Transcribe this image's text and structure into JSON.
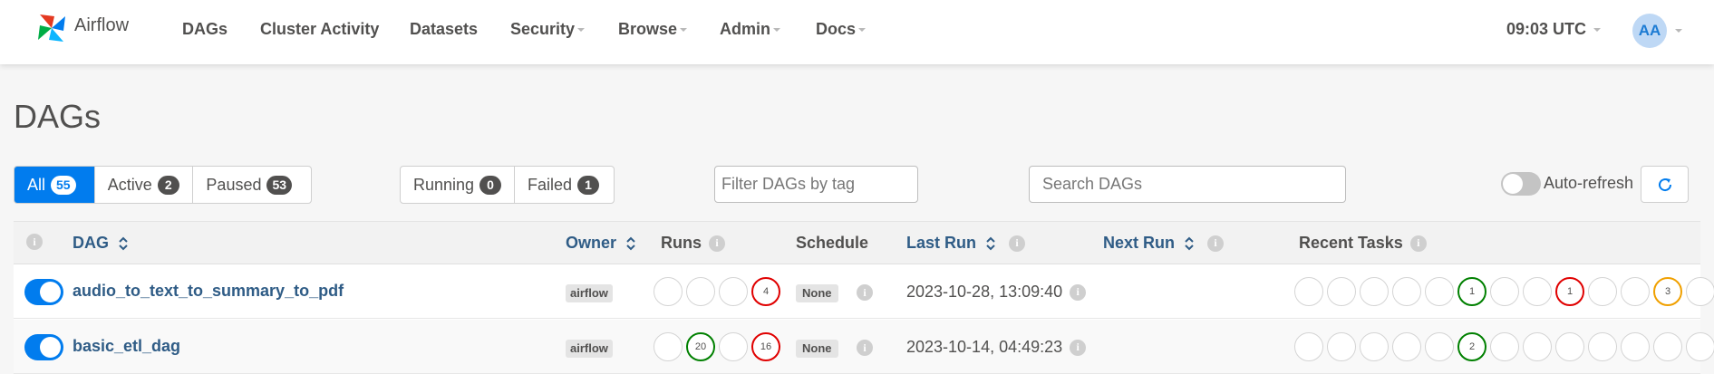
{
  "navbar": {
    "brand": "Airflow",
    "items": [
      {
        "label": "DAGs",
        "dropdown": false
      },
      {
        "label": "Cluster Activity",
        "dropdown": false
      },
      {
        "label": "Datasets",
        "dropdown": false
      },
      {
        "label": "Security",
        "dropdown": true
      },
      {
        "label": "Browse",
        "dropdown": true
      },
      {
        "label": "Admin",
        "dropdown": true
      },
      {
        "label": "Docs",
        "dropdown": true
      }
    ],
    "clock": "09:03 UTC",
    "avatar": "AA"
  },
  "page": {
    "title": "DAGs"
  },
  "status_filter": [
    {
      "label": "All",
      "count": "55"
    },
    {
      "label": "Active",
      "count": "2"
    },
    {
      "label": "Paused",
      "count": "53"
    }
  ],
  "run_filter": [
    {
      "label": "Running",
      "count": "0"
    },
    {
      "label": "Failed",
      "count": "1"
    }
  ],
  "tag_filter": {
    "placeholder": "Filter DAGs by tag"
  },
  "search": {
    "placeholder": "Search DAGs"
  },
  "auto_refresh": {
    "label": "Auto-refresh",
    "enabled": false
  },
  "table": {
    "headers": {
      "info": "i",
      "dag": "DAG",
      "owner": "Owner",
      "runs": "Runs",
      "schedule": "Schedule",
      "last_run": "Last Run",
      "next_run": "Next Run",
      "recent_tasks": "Recent Tasks"
    },
    "rows": [
      {
        "dag_id": "audio_to_text_to_summary_to_pdf",
        "owner": "airflow",
        "runs": [
          "",
          "",
          "",
          "4"
        ],
        "schedule": "None",
        "last_run": "2023-10-28, 13:09:40",
        "next_run": "",
        "recent_tasks": [
          "",
          "",
          "",
          "",
          "",
          "1",
          "",
          "",
          "1",
          "",
          "",
          "3",
          ""
        ]
      },
      {
        "dag_id": "basic_etl_dag",
        "owner": "airflow",
        "runs": [
          "",
          "20",
          "",
          "16"
        ],
        "schedule": "None",
        "last_run": "2023-10-14, 04:49:23",
        "next_run": "",
        "recent_tasks": [
          "",
          "",
          "",
          "",
          "",
          "2",
          "",
          "",
          "",
          "",
          "",
          "",
          ""
        ]
      }
    ]
  },
  "colors": {
    "primary": "#017cee",
    "link": "#2f5c86",
    "success": "#008000",
    "failed": "#e00000",
    "up_for_retry": "#f0a000"
  }
}
